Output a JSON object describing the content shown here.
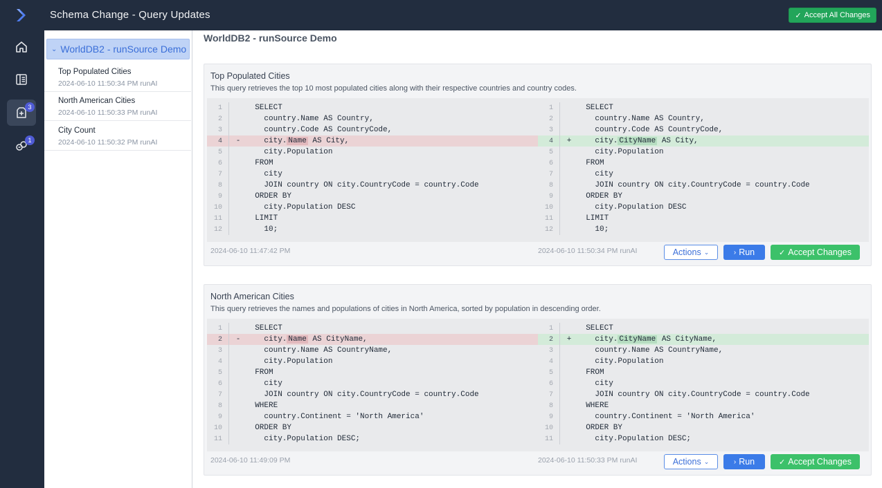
{
  "header": {
    "title": "Schema Change - Query Updates",
    "accept_all_label": "Accept All Changes"
  },
  "rail": {
    "items": [
      {
        "icon": "home-icon"
      },
      {
        "icon": "notebook-icon"
      },
      {
        "icon": "query-updates-icon",
        "badge": "3"
      },
      {
        "icon": "linked-items-icon",
        "badge": "1"
      }
    ]
  },
  "sidebar": {
    "group_label": "WorldDB2 - runSource Demo",
    "items": [
      {
        "name": "Top Populated Cities",
        "timestamp": "2024-06-10 11:50:34 PM",
        "author": "runAI"
      },
      {
        "name": "North American Cities",
        "timestamp": "2024-06-10 11:50:33 PM",
        "author": "runAI"
      },
      {
        "name": "City Count",
        "timestamp": "2024-06-10 11:50:32 PM",
        "author": "runAI"
      }
    ]
  },
  "main": {
    "title": "WorldDB2 - runSource Demo",
    "cards": [
      {
        "title": "Top Populated Cities",
        "description": "This query retrieves the top 10 most populated cities along with their respective countries and country codes.",
        "left_lines": [
          {
            "n": "1",
            "code": "  SELECT"
          },
          {
            "n": "2",
            "code": "    country.Name AS Country,"
          },
          {
            "n": "3",
            "code": "    country.Code AS CountryCode,"
          },
          {
            "n": "4",
            "marker": "-",
            "type": "del",
            "pre": "    city.",
            "hl": "Name",
            "post": " AS City,"
          },
          {
            "n": "5",
            "code": "    city.Population"
          },
          {
            "n": "6",
            "code": "  FROM"
          },
          {
            "n": "7",
            "code": "    city"
          },
          {
            "n": "8",
            "code": "    JOIN country ON city.CountryCode = country.Code"
          },
          {
            "n": "9",
            "code": "  ORDER BY"
          },
          {
            "n": "10",
            "code": "    city.Population DESC"
          },
          {
            "n": "11",
            "code": "  LIMIT"
          },
          {
            "n": "12",
            "code": "    10;"
          }
        ],
        "right_lines": [
          {
            "n": "1",
            "code": "  SELECT"
          },
          {
            "n": "2",
            "code": "    country.Name AS Country,"
          },
          {
            "n": "3",
            "code": "    country.Code AS CountryCode,"
          },
          {
            "n": "4",
            "marker": "+",
            "type": "add",
            "pre": "    city.",
            "hl": "CityName",
            "post": " AS City,"
          },
          {
            "n": "5",
            "code": "    city.Population"
          },
          {
            "n": "6",
            "code": "  FROM"
          },
          {
            "n": "7",
            "code": "    city"
          },
          {
            "n": "8",
            "code": "    JOIN country ON city.CountryCode = country.Code"
          },
          {
            "n": "9",
            "code": "  ORDER BY"
          },
          {
            "n": "10",
            "code": "    city.Population DESC"
          },
          {
            "n": "11",
            "code": "  LIMIT"
          },
          {
            "n": "12",
            "code": "    10;"
          }
        ],
        "left_timestamp": "2024-06-10 11:47:42 PM",
        "right_timestamp": "2024-06-10 11:50:34 PM",
        "right_author": "runAI",
        "actions_label": "Actions",
        "run_label": "Run",
        "accept_label": "Accept Changes"
      },
      {
        "title": "North American Cities",
        "description": "This query retrieves the names and populations of cities in North America, sorted by population in descending order.",
        "left_lines": [
          {
            "n": "1",
            "code": "  SELECT"
          },
          {
            "n": "2",
            "marker": "-",
            "type": "del",
            "pre": "    city.",
            "hl": "Name",
            "post": " AS CityName,"
          },
          {
            "n": "3",
            "code": "    country.Name AS CountryName,"
          },
          {
            "n": "4",
            "code": "    city.Population"
          },
          {
            "n": "5",
            "code": "  FROM"
          },
          {
            "n": "6",
            "code": "    city"
          },
          {
            "n": "7",
            "code": "    JOIN country ON city.CountryCode = country.Code"
          },
          {
            "n": "8",
            "code": "  WHERE"
          },
          {
            "n": "9",
            "code": "    country.Continent = 'North America'"
          },
          {
            "n": "10",
            "code": "  ORDER BY"
          },
          {
            "n": "11",
            "code": "    city.Population DESC;"
          }
        ],
        "right_lines": [
          {
            "n": "1",
            "code": "  SELECT"
          },
          {
            "n": "2",
            "marker": "+",
            "type": "add",
            "pre": "    city.",
            "hl": "CityName",
            "post": " AS CityName,"
          },
          {
            "n": "3",
            "code": "    country.Name AS CountryName,"
          },
          {
            "n": "4",
            "code": "    city.Population"
          },
          {
            "n": "5",
            "code": "  FROM"
          },
          {
            "n": "6",
            "code": "    city"
          },
          {
            "n": "7",
            "code": "    JOIN country ON city.CountryCode = country.Code"
          },
          {
            "n": "8",
            "code": "  WHERE"
          },
          {
            "n": "9",
            "code": "    country.Continent = 'North America'"
          },
          {
            "n": "10",
            "code": "  ORDER BY"
          },
          {
            "n": "11",
            "code": "    city.Population DESC;"
          }
        ],
        "left_timestamp": "2024-06-10 11:49:09 PM",
        "right_timestamp": "2024-06-10 11:50:33 PM",
        "right_author": "runAI",
        "actions_label": "Actions",
        "run_label": "Run",
        "accept_label": "Accept Changes"
      }
    ]
  },
  "colors": {
    "topbar": "#222d3f",
    "accept": "#3cc16a",
    "run": "#3b7be8",
    "deleted_line": "#ebd3d5",
    "added_line": "#d3ebd9"
  }
}
